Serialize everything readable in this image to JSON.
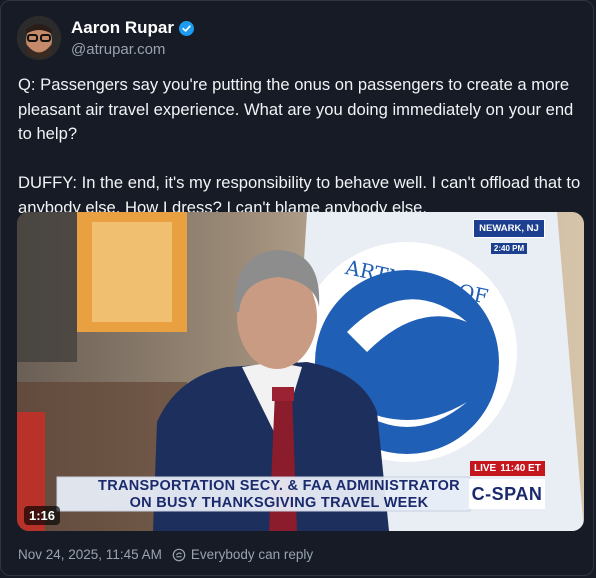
{
  "author": {
    "name": "Aaron Rupar",
    "handle": "@atrupar.com"
  },
  "post": {
    "text": "Q: Passengers say you're putting the onus on passengers to create a more pleasant air travel experience. What are you doing immediately on your end to help?\n\nDUFFY: In the end, it's my responsibility to behave well. I can't offload that to anybody else. How I dress? I can't blame anybody else.",
    "timestamp": "Nov 24, 2025, 11:45 AM",
    "reply_setting": "Everybody can reply"
  },
  "video": {
    "duration": "1:16",
    "chyron": "TRANSPORTATION SECY. & FAA ADMINISTRATOR ON BUSY THANKSGIVING TRAVEL WEEK",
    "network": "C-SPAN",
    "live_label": "LIVE",
    "live_time": "11:40 ET",
    "location": "NEWARK, NJ",
    "location_time": "2:40 PM",
    "seal_text": "ARTMENT OF"
  },
  "colors": {
    "background": "#161b26",
    "verified": "#1d9bf0",
    "secondary_text": "#9aa3b0"
  },
  "icons": {
    "verified": "verified-badge-icon",
    "reply": "reply-permission-icon"
  }
}
